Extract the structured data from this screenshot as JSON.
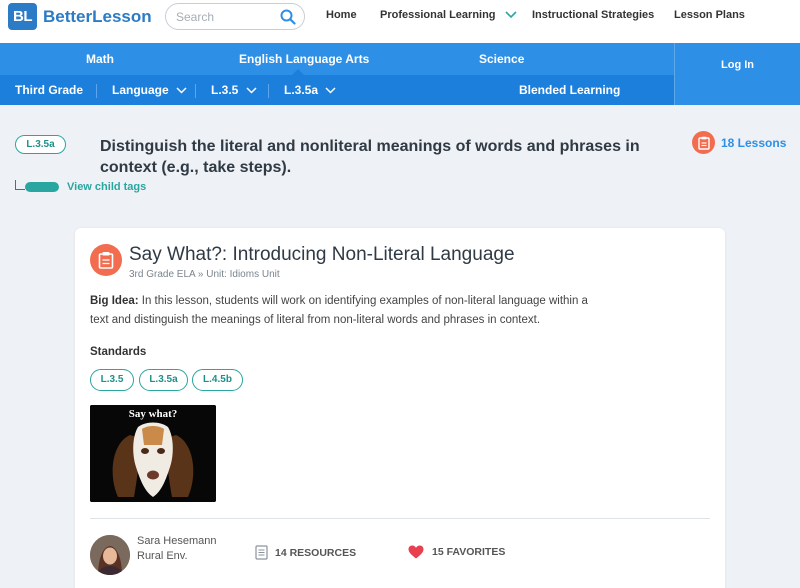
{
  "header": {
    "logo_badge": "BL",
    "logo_text": "BetterLesson",
    "search_placeholder": "Search",
    "nav": [
      "Home",
      "Professional Learning",
      "Instructional Strategies",
      "Lesson Plans"
    ]
  },
  "subjects": [
    "Math",
    "English Language Arts",
    "Science"
  ],
  "login_label": "Log In",
  "filters": {
    "grade": "Third Grade",
    "domain": "Language",
    "standard": "L.3.5",
    "substandard": "L.3.5a",
    "blended": "Blended Learning"
  },
  "tag": {
    "code": "L.3.5a",
    "description": "Distinguish the literal and nonliteral meanings of words and phrases in context (e.g., take steps).",
    "lessons_count": "18 Lessons",
    "child_tags_label": "View child tags"
  },
  "lesson": {
    "title": "Say What?: Introducing Non-Literal Language",
    "subtitle": "3rd Grade ELA » Unit: Idioms Unit",
    "big_idea_label": "Big Idea:",
    "big_idea_text": "In this lesson, students will work on identifying examples of non-literal language within a text and distinguish the meanings of literal from non-literal words and phrases in context.",
    "standards_label": "Standards",
    "standards": [
      "L.3.5",
      "L.3.5a",
      "L.4.5b"
    ],
    "thumbnail_caption": "Say what?",
    "author_name": "Sara Hesemann",
    "author_location": "Rural Env.",
    "resources": "14 RESOURCES",
    "favorites": "15 FAVORITES"
  },
  "colors": {
    "brand_blue": "#2b7bc6",
    "subject_bar": "#2e8fe6",
    "filter_bar": "#1c7fdc",
    "teal": "#2aa6a0",
    "lesson_orange": "#f26c4f",
    "favorite_red": "#e8404e"
  }
}
